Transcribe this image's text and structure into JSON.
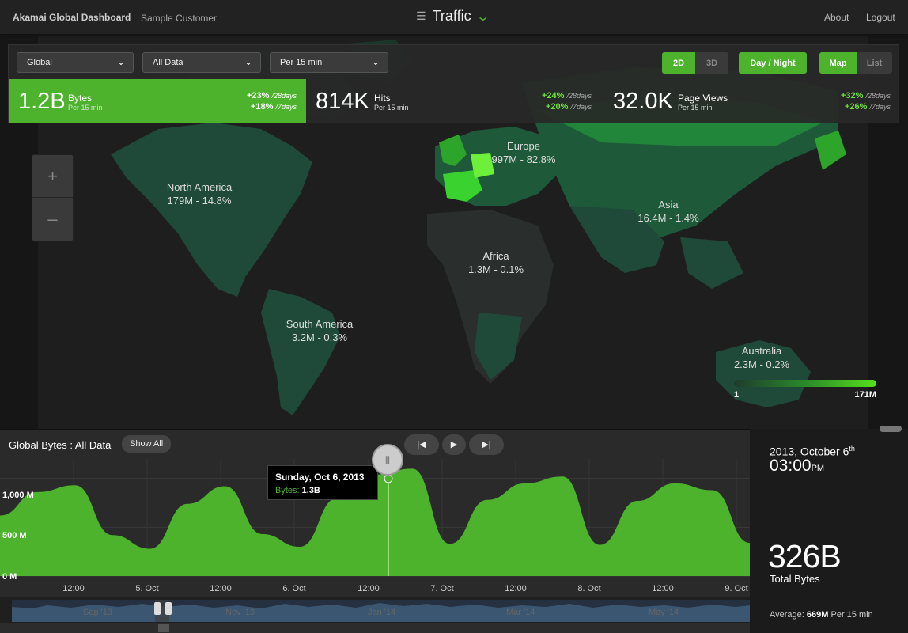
{
  "header": {
    "brand": "Akamai Global Dashboard",
    "customer": "Sample Customer",
    "section": "Traffic",
    "links": [
      "About",
      "Logout"
    ]
  },
  "filters": {
    "region": "Global",
    "data": "All Data",
    "interval": "Per 15 min"
  },
  "toggles": {
    "view_2d": "2D",
    "view_3d": "3D",
    "day_night": "Day / Night",
    "map": "Map",
    "list": "List"
  },
  "stats": [
    {
      "value": "1.2B",
      "label": "Bytes",
      "sub": "Per 15 min",
      "pct28": "+23%",
      "pct7": "+18%",
      "suffix28": "/28days",
      "suffix7": "/7days"
    },
    {
      "value": "814K",
      "label": "Hits",
      "sub": "Per 15 min",
      "pct28": "+24%",
      "pct7": "+20%",
      "suffix28": "/28days",
      "suffix7": "/7days"
    },
    {
      "value": "32.0K",
      "label": "Page Views",
      "sub": "Per 15 min",
      "pct28": "+32%",
      "pct7": "+26%",
      "suffix28": "/28days",
      "suffix7": "/7days"
    }
  ],
  "zoom": {
    "plus": "+",
    "minus": "–"
  },
  "regions": [
    {
      "name": "Europe",
      "value": "997M - 82.8%"
    },
    {
      "name": "North America",
      "value": "179M - 14.8%"
    },
    {
      "name": "Asia",
      "value": "16.4M - 1.4%"
    },
    {
      "name": "Africa",
      "value": "1.3M - 0.1%"
    },
    {
      "name": "South America",
      "value": "3.2M - 0.3%"
    },
    {
      "name": "Australia",
      "value": "2.3M - 0.2%"
    }
  ],
  "legend": {
    "min": "1",
    "max": "171M"
  },
  "chart": {
    "title": "Global Bytes : All Data",
    "show_all": "Show All",
    "tooltip_date": "Sunday, Oct 6, 2013",
    "tooltip_label": "Bytes:",
    "tooltip_value": "1.3B",
    "navigator_labels": [
      "Sep '13",
      "Nov '13",
      "Jan '14",
      "Mar '14",
      "May '14"
    ]
  },
  "chart_data": {
    "type": "area",
    "x": [
      "Oct 4 00:00",
      "Oct 4 06:00",
      "Oct 4 12:00",
      "Oct 4 18:00",
      "Oct 5 00:00",
      "Oct 5 06:00",
      "Oct 5 12:00",
      "Oct 5 18:00",
      "Oct 6 00:00",
      "Oct 6 06:00",
      "Oct 6 12:00",
      "Oct 6 18:00",
      "Oct 7 00:00",
      "Oct 7 06:00",
      "Oct 7 12:00",
      "Oct 7 18:00",
      "Oct 8 00:00",
      "Oct 8 06:00",
      "Oct 8 12:00",
      "Oct 8 18:00",
      "Oct 9 00:00"
    ],
    "x_ticks": [
      "12:00",
      "5. Oct",
      "12:00",
      "6. Oct",
      "12:00",
      "7. Oct",
      "12:00",
      "8. Oct",
      "12:00",
      "9. Oct"
    ],
    "series": [
      {
        "name": "Bytes",
        "values": [
          620,
          860,
          930,
          420,
          280,
          740,
          920,
          430,
          300,
          800,
          1040,
          1100,
          330,
          780,
          950,
          1020,
          320,
          770,
          950,
          880,
          340
        ]
      }
    ],
    "y_ticks": [
      "0 M",
      "500 M",
      "1,000 M"
    ],
    "ylim": [
      0,
      1200
    ],
    "color": "#4db32d"
  },
  "summary": {
    "date_prefix": "2013, October 6",
    "date_suffix": "th",
    "time": "03:00",
    "ampm": "PM",
    "total": "326B",
    "total_label": "Total Bytes",
    "avg_label": "Average:",
    "avg_value": "669M",
    "avg_unit": "Per 15 min"
  }
}
